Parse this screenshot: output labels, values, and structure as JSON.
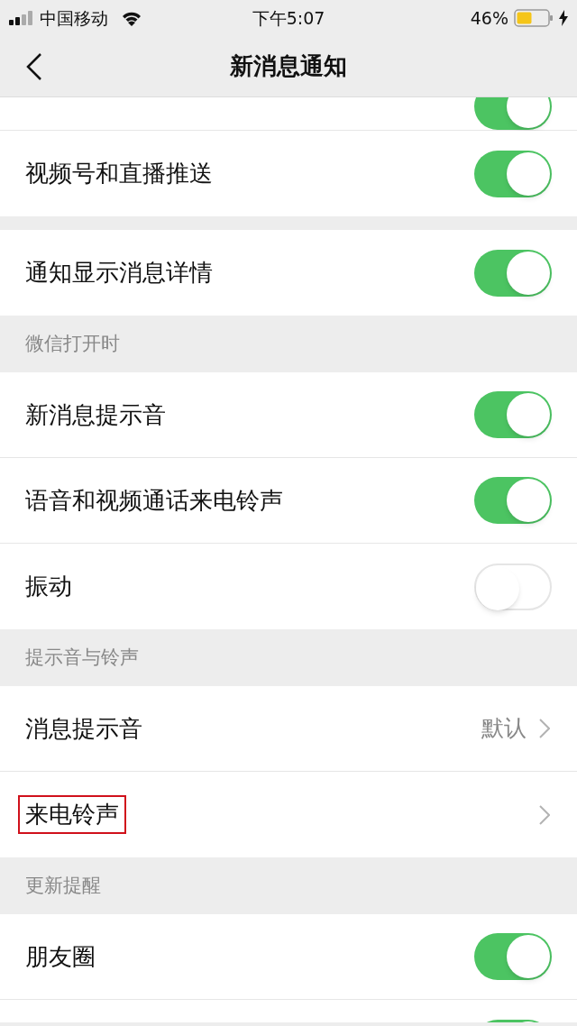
{
  "status_bar": {
    "carrier": "中国移动",
    "time": "下午5:07",
    "battery": "46%"
  },
  "nav": {
    "title": "新消息通知"
  },
  "top_partial": {
    "on": true
  },
  "sections": [
    {
      "items": [
        {
          "kind": "toggle",
          "label": "视频号和直播推送",
          "on": true
        }
      ]
    },
    {
      "items": [
        {
          "kind": "toggle",
          "label": "通知显示消息详情",
          "on": true
        }
      ]
    },
    {
      "header": "微信打开时",
      "items": [
        {
          "kind": "toggle",
          "label": "新消息提示音",
          "on": true
        },
        {
          "kind": "toggle",
          "label": "语音和视频通话来电铃声",
          "on": true
        },
        {
          "kind": "toggle",
          "label": "振动",
          "on": false
        }
      ]
    },
    {
      "header": "提示音与铃声",
      "items": [
        {
          "kind": "link",
          "label": "消息提示音",
          "value": "默认",
          "highlighted": false
        },
        {
          "kind": "link",
          "label": "来电铃声",
          "highlighted": true
        }
      ]
    },
    {
      "header": "更新提醒",
      "items": [
        {
          "kind": "toggle",
          "label": "朋友圈",
          "on": true
        }
      ]
    }
  ],
  "bottom_partial": {
    "on": true
  }
}
